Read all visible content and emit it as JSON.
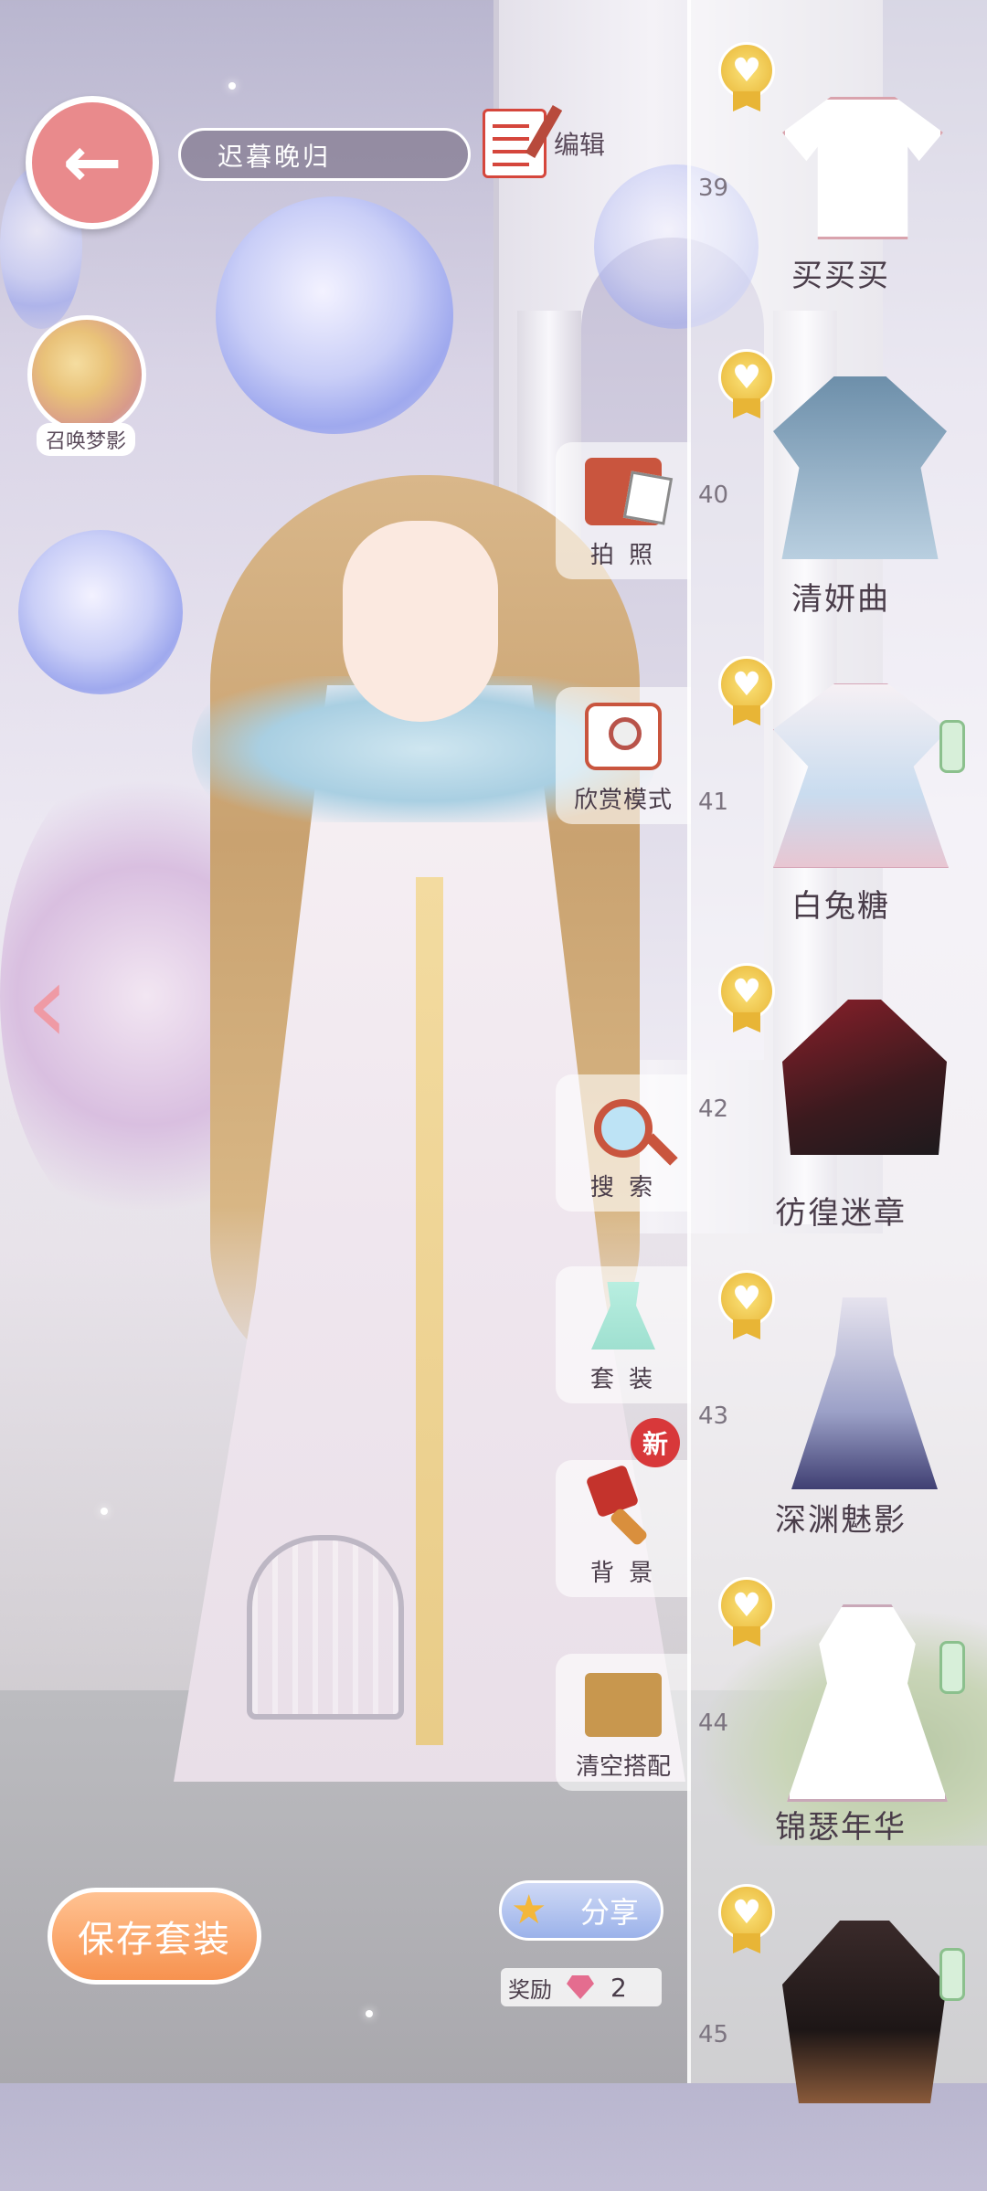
{
  "header": {
    "outfit_name": "迟暮晚归",
    "edit_label": "编辑"
  },
  "summon": {
    "label": "召唤梦影"
  },
  "side_menu": {
    "photo_label": "拍 照",
    "appreciate_label": "欣赏模式",
    "search_label": "搜 索",
    "suit_label": "套 装",
    "background_label": "背 景",
    "new_badge": "新",
    "clear_label": "清空搭配"
  },
  "bottom": {
    "save_label": "保存套装",
    "share_label": "分享",
    "reward_label": "奖励",
    "reward_count": "2"
  },
  "outfits": [
    {
      "num": "39",
      "name": "买买买"
    },
    {
      "num": "40",
      "name": "清妍曲"
    },
    {
      "num": "41",
      "name": "白兔糖"
    },
    {
      "num": "42",
      "name": "彷徨迷章"
    },
    {
      "num": "43",
      "name": "深渊魅影"
    },
    {
      "num": "44",
      "name": "锦瑟年华"
    },
    {
      "num": "45",
      "name": ""
    }
  ]
}
